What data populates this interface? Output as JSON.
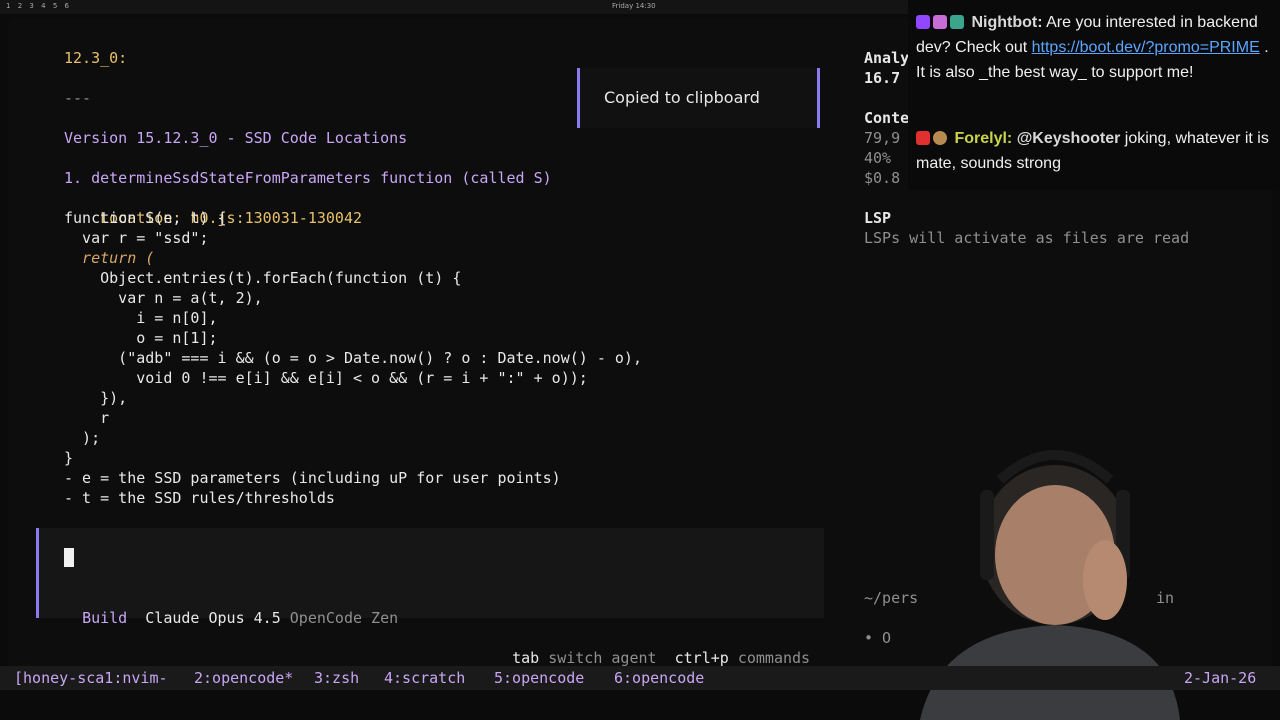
{
  "topbar": {
    "workspaces": [
      "1",
      "2",
      "3",
      "4",
      "5",
      "6"
    ],
    "clock": "Friday 14:30"
  },
  "editor": {
    "lines": [
      {
        "text": "12.3_0:",
        "cls": "y"
      },
      {
        "text": "---",
        "cls": "m"
      },
      {
        "text": "Version 15.12.3_0 - SSD Code Locations",
        "cls": "p"
      },
      {
        "text": "1. determineSsdStateFromParameters function (called S)",
        "cls": "p"
      }
    ],
    "location_label": "Location:",
    "location_value": "h0.js:130031-130042",
    "code": [
      "function S(e, t) {",
      "  var r = \"ssd\";",
      "  return (",
      "    Object.entries(t).forEach(function (t) {",
      "      var n = a(t, 2),",
      "        i = n[0],",
      "        o = n[1];",
      "      (\"adb\" === i && (o = o > Date.now() ? o : Date.now() - o),",
      "        void 0 !== e[i] && e[i] < o && (r = i + \":\" + o));",
      "    }),",
      "    r",
      "  );",
      "}"
    ],
    "notes": [
      "- e = the SSD parameters (including uP for user points)",
      "- t = the SSD rules/thresholds"
    ]
  },
  "toast": {
    "text": "Copied to clipboard"
  },
  "prompt": {
    "mode": "Build",
    "model": "Claude Opus 4.5",
    "provider": "OpenCode Zen"
  },
  "hints": {
    "tab_key": "tab",
    "tab_label": "switch agent",
    "cmd_key": "ctrl+p",
    "cmd_label": "commands"
  },
  "sidebar": {
    "analysis_label": "Analy",
    "analysis_value": "16.7",
    "context_label": "Conte",
    "context_lines": [
      "79,9",
      "40% ",
      "$0.8"
    ],
    "lsp_title": "LSP",
    "lsp_text": "LSPs will activate as files are read",
    "path": "~/pers",
    "path_end": "in",
    "status": "• O"
  },
  "tmux": {
    "session": "[honey-sca1:nvim-",
    "windows": [
      "2:opencode*",
      "3:zsh",
      "4:scratch",
      "5:opencode",
      "6:opencode"
    ],
    "date": "2-Jan-26"
  },
  "chat": {
    "msg1_user": "Nightbot:",
    "msg1_text_a": " Are you interested in backend dev? Check out ",
    "msg1_link": "https://boot.dev/?promo=PRIME",
    "msg1_text_b": " . It is also _the best way_ to support me!",
    "msg2_user": "Forelyl:",
    "msg2_mention": "@Keyshooter",
    "msg2_text": " joking, whatever it is mate, sounds strong"
  },
  "colors": {
    "accent": "#8a7cf0",
    "heading": "#c9a6f5",
    "keyword": "#d7a66a",
    "yellow": "#e8c16a"
  }
}
